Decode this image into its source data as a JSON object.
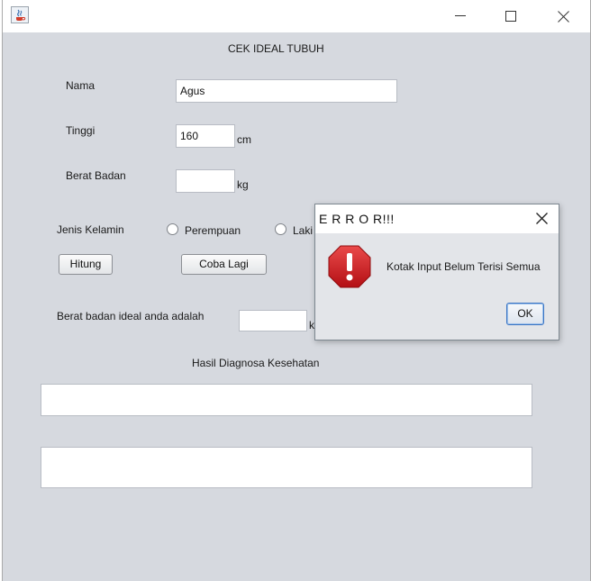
{
  "window": {
    "app_icon": "java-coffee-cup-icon",
    "controls": [
      "minimize-icon",
      "maximize-icon",
      "close-icon"
    ]
  },
  "form": {
    "heading": "CEK IDEAL TUBUH",
    "nama_label": "Nama",
    "nama_value": "Agus",
    "tinggi_label": "Tinggi",
    "tinggi_value": "160",
    "tinggi_unit": "cm",
    "berat_label": "Berat Badan",
    "berat_value": "",
    "berat_unit": "kg",
    "gender_label": "Jenis Kelamin",
    "gender_options": [
      "Perempuan",
      "Laki"
    ],
    "hitung_button": "Hitung",
    "coba_lagi_button": "Coba Lagi",
    "ideal_label": "Berat badan ideal anda adalah",
    "ideal_value": "",
    "ideal_unit": "k",
    "diagnosa_heading": "Hasil Diagnosa Kesehatan",
    "diagnosa_value_1": "",
    "diagnosa_value_2": ""
  },
  "dialog": {
    "title": "E R R O R!!!",
    "message": "Kotak Input Belum Terisi Semua",
    "ok_button": "OK",
    "icon": "error-stop-icon"
  },
  "colors": {
    "window_bg": "#d6d9df",
    "dialog_bg": "#e3e5e9",
    "error_red": "#c9161b",
    "ok_focus_border": "#3a74c4"
  }
}
